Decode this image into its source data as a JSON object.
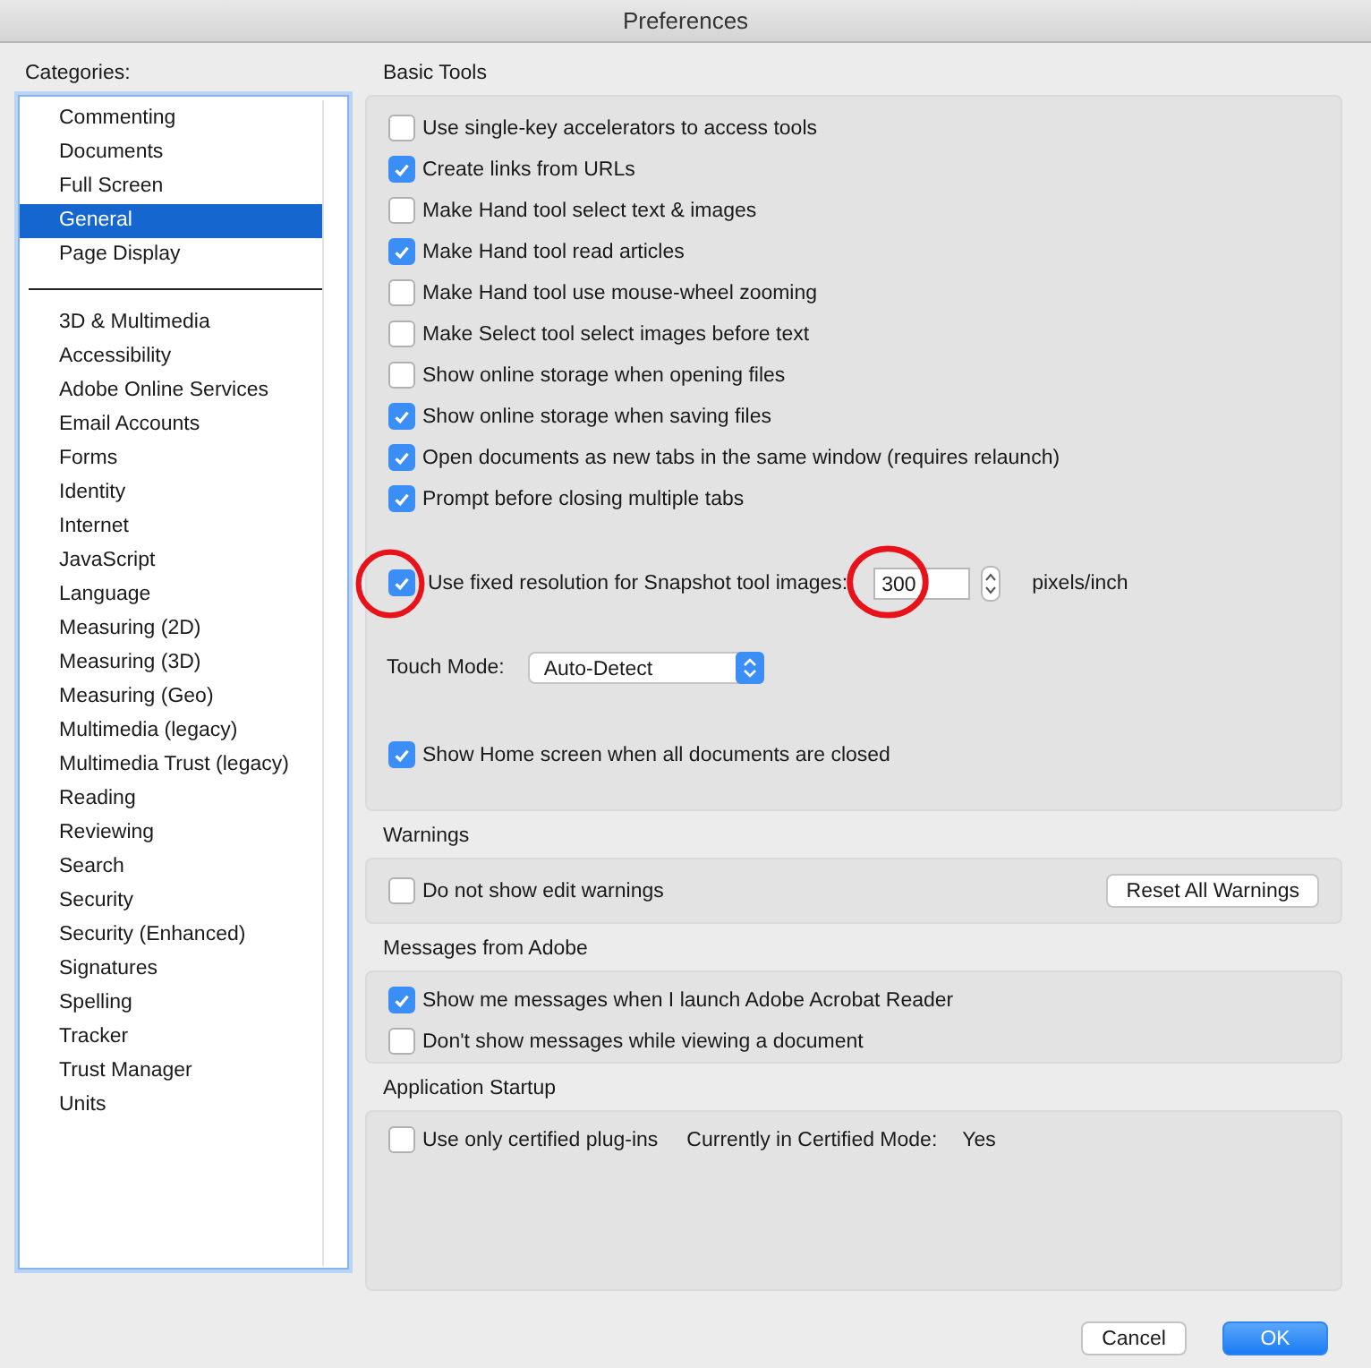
{
  "window": {
    "title": "Preferences"
  },
  "categories": {
    "label": "Categories:",
    "groups": [
      [
        {
          "label": "Commenting",
          "selected": false
        },
        {
          "label": "Documents",
          "selected": false
        },
        {
          "label": "Full Screen",
          "selected": false
        },
        {
          "label": "General",
          "selected": true
        },
        {
          "label": "Page Display",
          "selected": false
        }
      ],
      [
        {
          "label": "3D & Multimedia",
          "selected": false
        },
        {
          "label": "Accessibility",
          "selected": false
        },
        {
          "label": "Adobe Online Services",
          "selected": false
        },
        {
          "label": "Email Accounts",
          "selected": false
        },
        {
          "label": "Forms",
          "selected": false
        },
        {
          "label": "Identity",
          "selected": false
        },
        {
          "label": "Internet",
          "selected": false
        },
        {
          "label": "JavaScript",
          "selected": false
        },
        {
          "label": "Language",
          "selected": false
        },
        {
          "label": "Measuring (2D)",
          "selected": false
        },
        {
          "label": "Measuring (3D)",
          "selected": false
        },
        {
          "label": "Measuring (Geo)",
          "selected": false
        },
        {
          "label": "Multimedia (legacy)",
          "selected": false
        },
        {
          "label": "Multimedia Trust (legacy)",
          "selected": false
        },
        {
          "label": "Reading",
          "selected": false
        },
        {
          "label": "Reviewing",
          "selected": false
        },
        {
          "label": "Search",
          "selected": false
        },
        {
          "label": "Security",
          "selected": false
        },
        {
          "label": "Security (Enhanced)",
          "selected": false
        },
        {
          "label": "Signatures",
          "selected": false
        },
        {
          "label": "Spelling",
          "selected": false
        },
        {
          "label": "Tracker",
          "selected": false
        },
        {
          "label": "Trust Manager",
          "selected": false
        },
        {
          "label": "Units",
          "selected": false
        }
      ]
    ]
  },
  "basic_tools": {
    "title": "Basic Tools",
    "options": [
      {
        "label": "Use single-key accelerators to access tools",
        "checked": false
      },
      {
        "label": "Create links from URLs",
        "checked": true
      },
      {
        "label": "Make Hand tool select text & images",
        "checked": false
      },
      {
        "label": "Make Hand tool read articles",
        "checked": true
      },
      {
        "label": "Make Hand tool use mouse-wheel zooming",
        "checked": false
      },
      {
        "label": "Make Select tool select images before text",
        "checked": false
      },
      {
        "label": "Show online storage when opening files",
        "checked": false
      },
      {
        "label": "Show online storage when saving files",
        "checked": true
      },
      {
        "label": "Open documents as new tabs in the same window (requires relaunch)",
        "checked": true
      },
      {
        "label": "Prompt before closing multiple tabs",
        "checked": true
      }
    ],
    "snapshot": {
      "label": "Use fixed resolution for Snapshot tool images:",
      "checked": true,
      "value": "300",
      "unit": "pixels/inch",
      "checkbox_circled": true,
      "field_circled": true
    },
    "touch_mode": {
      "label": "Touch Mode:",
      "value": "Auto-Detect"
    },
    "home_screen": {
      "label": "Show Home screen when all documents are closed",
      "checked": true
    }
  },
  "warnings": {
    "title": "Warnings",
    "option": {
      "label": "Do not show edit warnings",
      "checked": false
    },
    "button": "Reset All Warnings"
  },
  "messages": {
    "title": "Messages from Adobe",
    "options": [
      {
        "label": "Show me messages when I launch Adobe Acrobat Reader",
        "checked": true
      },
      {
        "label": "Don't show messages while viewing a document",
        "checked": false
      }
    ]
  },
  "startup": {
    "title": "Application Startup",
    "option": {
      "label": "Use only certified plug-ins",
      "checked": false
    },
    "status_label": "Currently in Certified Mode:",
    "status_value": "Yes"
  },
  "buttons": [
    {
      "label": "Cancel",
      "kind": "normal"
    },
    {
      "label": "OK",
      "kind": "default"
    }
  ]
}
